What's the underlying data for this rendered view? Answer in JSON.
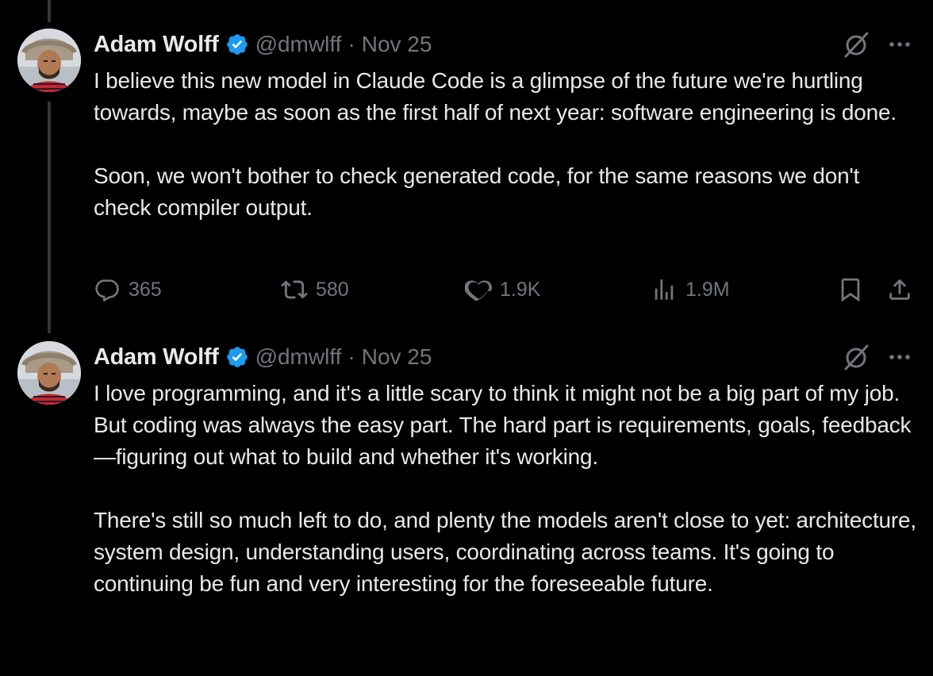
{
  "tweets": [
    {
      "author_name": "Adam Wolff",
      "handle": "@dmwlff",
      "separator": "·",
      "date": "Nov 25",
      "paragraphs": [
        "I believe this new model in Claude Code is a glimpse of the future we're hurtling towards, maybe as soon as the first half of next year: software engineering is done.",
        "Soon, we won't bother to check generated code, for the same reasons we don't check compiler output."
      ],
      "stats": {
        "replies": "365",
        "reposts": "580",
        "likes": "1.9K",
        "views": "1.9M"
      }
    },
    {
      "author_name": "Adam Wolff",
      "handle": "@dmwlff",
      "separator": "·",
      "date": "Nov 25",
      "paragraphs": [
        "I love programming, and it's a little scary to think it might not be a big part of my job. But coding was always the easy part. The hard part is requirements, goals, feedback—figuring out what to build and whether it's working.",
        "There's still so much left to do, and plenty the models aren't close to yet: architecture, system design, understanding users, coordinating across teams. It's going to continuing be fun and very interesting for the foreseeable future."
      ]
    }
  ],
  "icons": {
    "verified": "verified-badge-icon",
    "grok": "grok-icon",
    "more": "more-icon",
    "reply": "reply-icon",
    "repost": "repost-icon",
    "like": "heart-icon",
    "views": "views-icon",
    "bookmark": "bookmark-icon",
    "share": "share-icon"
  },
  "colors": {
    "background": "#000000",
    "text": "#e7e9ea",
    "secondary": "#71767b",
    "verified": "#1d9bf0",
    "thread_line": "#333639"
  }
}
